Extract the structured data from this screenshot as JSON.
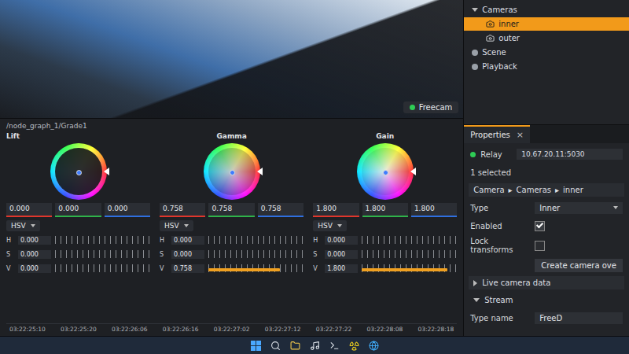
{
  "viewport": {
    "camera_badge": "Freecam",
    "live": true
  },
  "outliner": {
    "items": [
      {
        "label": "Cameras",
        "depth": 0,
        "expanded": true,
        "selected": false
      },
      {
        "label": "inner",
        "depth": 1,
        "expanded": false,
        "selected": true
      },
      {
        "label": "outer",
        "depth": 1,
        "expanded": false,
        "selected": false
      },
      {
        "label": "Scene",
        "depth": 0,
        "expanded": false,
        "selected": false
      },
      {
        "label": "Playback",
        "depth": 0,
        "expanded": false,
        "selected": false
      }
    ]
  },
  "grade": {
    "path": "/node_graph_1/Grade1",
    "wheels": [
      {
        "label": "Lift",
        "level": 0,
        "channels": [
          {
            "value": "0.000",
            "color": "#e0362c"
          },
          {
            "value": "0.000",
            "color": "#2fb34a"
          },
          {
            "value": "0.000",
            "color": "#2f6fe0"
          }
        ],
        "mode": "HSV",
        "hsv": [
          {
            "label": "H",
            "value": "0.000",
            "level": 0
          },
          {
            "label": "S",
            "value": "0.000",
            "level": 0
          },
          {
            "label": "V",
            "value": "0.000",
            "level": 0
          }
        ]
      },
      {
        "label": "Gamma",
        "level": 0.75,
        "channels": [
          {
            "value": "0.758",
            "color": "#e0362c"
          },
          {
            "value": "0.758",
            "color": "#2fb34a"
          },
          {
            "value": "0.758",
            "color": "#2f6fe0"
          }
        ],
        "mode": "HSV",
        "hsv": [
          {
            "label": "H",
            "value": "0.000",
            "level": 0
          },
          {
            "label": "S",
            "value": "0.000",
            "level": 0
          },
          {
            "label": "V",
            "value": "0.758",
            "level": 0.75
          }
        ]
      },
      {
        "label": "Gain",
        "level": 0.9,
        "channels": [
          {
            "value": "1.800",
            "color": "#e0362c"
          },
          {
            "value": "1.800",
            "color": "#2fb34a"
          },
          {
            "value": "1.800",
            "color": "#2f6fe0"
          }
        ],
        "mode": "HSV",
        "hsv": [
          {
            "label": "H",
            "value": "0.000",
            "level": 0
          },
          {
            "label": "S",
            "value": "0.000",
            "level": 0
          },
          {
            "label": "V",
            "value": "1.800",
            "level": 0.9
          }
        ]
      }
    ]
  },
  "timeline": {
    "ticks": [
      "03:22:25:10",
      "03:22:25:20",
      "03:22:26:06",
      "03:22:26:16",
      "03:22:27:02",
      "03:22:27:12",
      "03:22:27:22",
      "03:22:28:08",
      "03:22:28:18"
    ]
  },
  "properties": {
    "tab": "Properties",
    "close": "×",
    "relay": {
      "label": "Relay",
      "address": "10.67.20.11:5030",
      "connected": true
    },
    "selection": "1 selected",
    "breadcrumb": {
      "items": [
        "Camera",
        "Cameras",
        "inner"
      ],
      "separator": "▸"
    },
    "fields": [
      {
        "kind": "select",
        "label": "Type",
        "value": "Inner"
      },
      {
        "kind": "checkbox",
        "label": "Enabled",
        "checked": true
      },
      {
        "kind": "checkbox",
        "label": "Lock transforms",
        "checked": false
      },
      {
        "kind": "button",
        "label": "Create camera ove"
      }
    ],
    "sections": [
      {
        "label": "Live camera data",
        "expanded": false,
        "fields": []
      },
      {
        "label": "Stream",
        "expanded": true,
        "fields": [
          {
            "label": "Type name",
            "value": "FreeD"
          }
        ]
      }
    ]
  }
}
